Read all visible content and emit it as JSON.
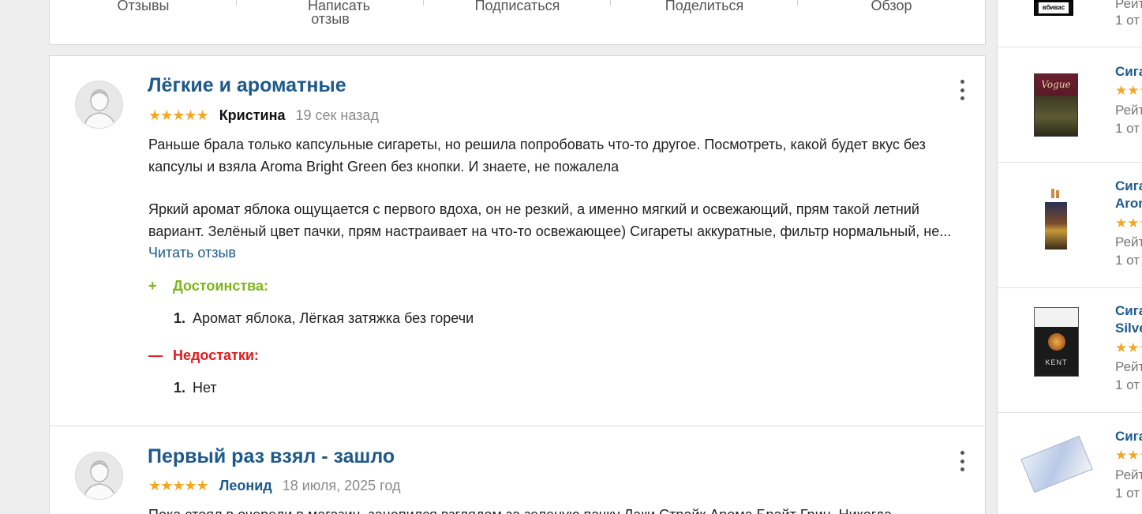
{
  "action_bar": {
    "items": [
      "Отзывы",
      "Написать отзыв",
      "Подписаться",
      "Поделиться",
      "Обзор"
    ]
  },
  "reviews": [
    {
      "title": "Лёгкие и ароматные",
      "stars": "★★★★★",
      "author": "Кристина",
      "date": "19 сек назад",
      "text_p1": "Раньше брала только капсульные сигареты, но решила попробовать что-то другое. Посмотреть, какой будет вкус без капсулы и взяла Aroma Bright Green без кнопки. И знаете, не пожалела",
      "text_p2": "Яркий аромат яблока ощущается с первого вдоха, он не резкий, а именно мягкий и освежающий, прям такой летний вариант. Зелёный цвет пачки, прям настраивает на что-то освежающее) Сигареты аккуратные, фильтр нормальный, не...",
      "read_more": "Читать отзыв",
      "pros_label": "Достоинства:",
      "pros_sign": "+",
      "pros": [
        {
          "num": "1.",
          "text": "Аромат яблока, Лёгкая затяжка без горечи"
        }
      ],
      "cons_label": "Недостатки:",
      "cons_sign": "—",
      "cons": [
        {
          "num": "1.",
          "text": "Нет"
        }
      ]
    },
    {
      "title": "Первый раз взял - зашло",
      "stars": "★★★★★",
      "author": "Леонид",
      "date": "18 июля, 2025 год",
      "text_p1": "Пока стоял в очереди в магазин, зацепился взглядом за зеленую пачку Лаки Страйк Арома Брайт Грин. Никогда"
    }
  ],
  "sidebar": {
    "items": [
      {
        "title": "",
        "stars": "",
        "rating": "Рейт",
        "count": "1 от",
        "thumb_label": "вбивас"
      },
      {
        "title": "Сига",
        "stars": "★★★",
        "rating": "Рейт",
        "count": "1 от",
        "thumb_label": "Vogue"
      },
      {
        "title": "Сига",
        "title2": "Arom",
        "stars": "★★★",
        "rating": "Рейт",
        "count": "1 от"
      },
      {
        "title": "Сига",
        "title2": "Silve",
        "stars": "★★★",
        "rating": "Рейт",
        "count": "1 от",
        "thumb_label": "KENT"
      },
      {
        "title": "Сига",
        "stars": "★★★",
        "rating": "Рейт",
        "count": "1 от"
      }
    ]
  },
  "colors": {
    "link": "#1d5a8c",
    "star": "#f5a623",
    "pros": "#7cb518",
    "cons": "#e3191c"
  }
}
